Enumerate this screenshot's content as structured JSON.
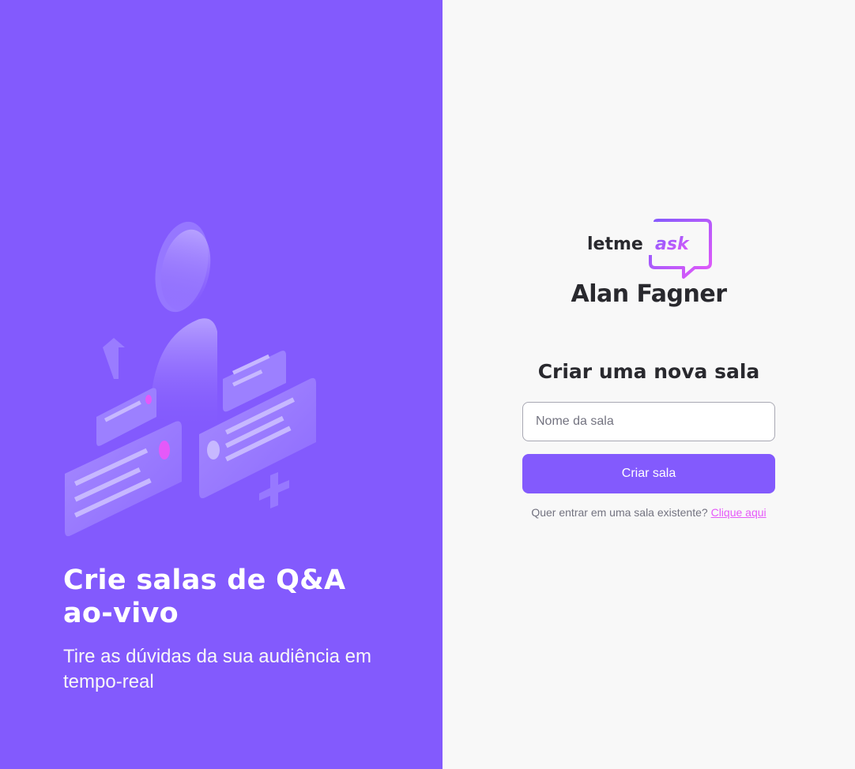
{
  "aside": {
    "illustration_icon": "qa-illustration",
    "title": "Crie salas de Q&A ao-vivo",
    "subtitle": "Tire as dúvidas da sua audiência em tempo-real"
  },
  "main": {
    "logo_text_a": "letme",
    "logo_text_b": "ask",
    "user_name": "Alan Fagner",
    "form_title": "Criar uma nova sala",
    "room_input": {
      "placeholder": "Nome da sala",
      "value": ""
    },
    "create_button_label": "Criar sala",
    "enter_text": "Quer entrar em uma sala existente?",
    "enter_link_label": "Clique aqui"
  },
  "colors": {
    "brand_purple": "#835afd",
    "accent_pink": "#e559f9",
    "text_dark": "#29292e",
    "text_muted": "#737380",
    "background": "#f8f8f8"
  }
}
